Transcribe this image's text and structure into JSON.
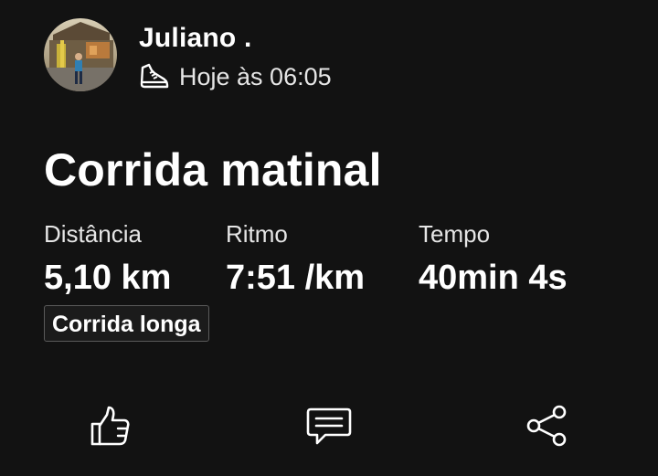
{
  "activity": {
    "athlete_name": "Juliano .",
    "sport_icon": "running-shoe-icon",
    "timestamp": "Hoje às 06:05",
    "title": "Corrida matinal",
    "tag": "Corrida longa"
  },
  "stats": [
    {
      "label": "Distância",
      "value": "5,10 km"
    },
    {
      "label": "Ritmo",
      "value": "7:51 /km"
    },
    {
      "label": "Tempo",
      "value": "40min 4s"
    }
  ],
  "actions": {
    "kudos_icon": "thumbs-up-icon",
    "comment_icon": "comment-icon",
    "share_icon": "share-icon"
  },
  "colors": {
    "background": "#121212",
    "text": "#ffffff",
    "secondary_text": "#e6e6e6",
    "tag_border": "#5a5a5a"
  }
}
